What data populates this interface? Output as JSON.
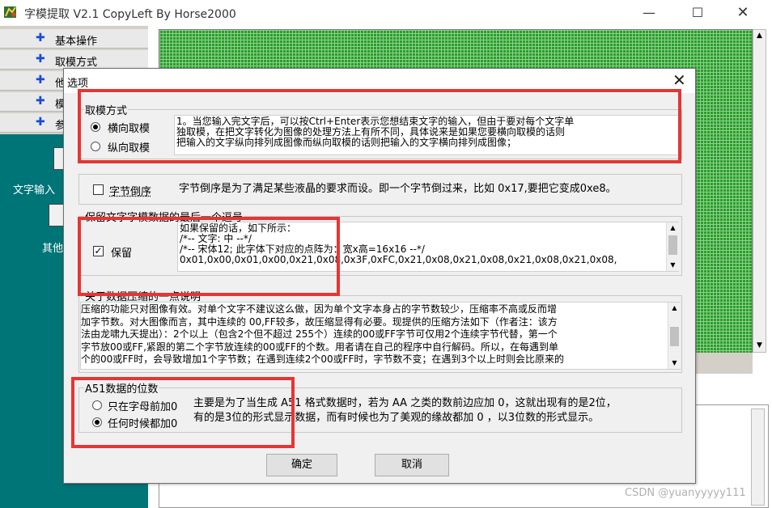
{
  "app": {
    "title": "字模提取 V2.1  CopyLeft By Horse2000",
    "minimize": "—",
    "maximize": "☐",
    "close": "✕"
  },
  "left_menu": {
    "items": [
      {
        "label": "基本操作"
      },
      {
        "label": "取模方式"
      },
      {
        "label": "他"
      },
      {
        "label": "模"
      },
      {
        "label": "参"
      }
    ],
    "text_input_label": "文字输入",
    "other_label": "其他"
  },
  "dialog": {
    "title": "选项",
    "close": "✕",
    "mode_group": {
      "legend": "取模方式",
      "options": [
        "横向取模",
        "纵向取模"
      ],
      "selected": 0,
      "description_lines": [
        "1。当您输入完文字后，可以按Ctrl+Enter表示您想结束文字的输入，但由于要对每个文字单",
        "独取模，在把文字转化为图像的处理方法上有所不同，具体说来是如果您要横向取模的话则",
        "把输入的文字纵向排列成图像而纵向取模的话则把输入的文字横向排列成图像；"
      ]
    },
    "byte_reverse": {
      "label": "字节倒序",
      "checked": false,
      "description": "字节倒序是为了满足某些液晶的要求而设。即一个字节倒过来，比如 0x17,要把它变成0xe8。"
    },
    "keep_group": {
      "legend": "保留文字字模数据的最后一个逗号",
      "label": "保留",
      "checked": true,
      "mark": "✓",
      "example_lines": [
        "如果保留的话，如下所示：",
        "/*--  文字:  中  --*/",
        "/*--  宋体12;  此字体下对应的点阵为：宽x高=16x16   --*/",
        "0x01,0x00,0x01,0x00,0x21,0x08,0x3F,0xFC,0x21,0x08,0x21,0x08,0x21,0x08,0x21,0x08,"
      ]
    },
    "compress_group": {
      "legend": "关于数据压缩的一点说明",
      "lines": [
        "压缩的功能只对图像有效。对单个文字不建议这么做，因为单个文字本身占的字节数较少，压缩率不高或反而增",
        "加字节数。对大图像而言，其中连续的 00,FF较多，故压缩显得有必要。现提供的压缩方法如下（作者注：该方",
        "法由龙啸九天提出）：2个以上（包含2个但不超过 255个）连续的00或FF字节可仅用2个连续字节代替，第一个",
        "字节放00或FF,紧跟的第二个字节放连续的00或FF的个数。用者请在自己的程序中自行解码。所以，在每遇到单",
        "个的00或FF时，会导致增加1个字节数；在遇到连续2个00或FF时，字节数不变；在遇到3个以上时则会比原来的"
      ]
    },
    "a51_group": {
      "legend": "A51数据的位数",
      "options": [
        "只在字母前加0",
        "任何时候都加0"
      ],
      "selected": 1,
      "description_lines": [
        "主要是为了当生成 A51 格式数据时，若为 AA 之类的数前边应加 0，这就出现有的是2位，",
        "有的是3位的形式显示数据，而有时候也为了美观的缘故都加 0 ，以3位数的形式显示。"
      ]
    },
    "ok_button": "确定",
    "cancel_button": "取消"
  },
  "watermark": "CSDN @yuanyyyyy111",
  "colors": {
    "annotation_red": "#e83434",
    "teal": "#007577",
    "grid_green": "#2a9d2a",
    "menu_plus_blue": "#1a4ad8"
  }
}
